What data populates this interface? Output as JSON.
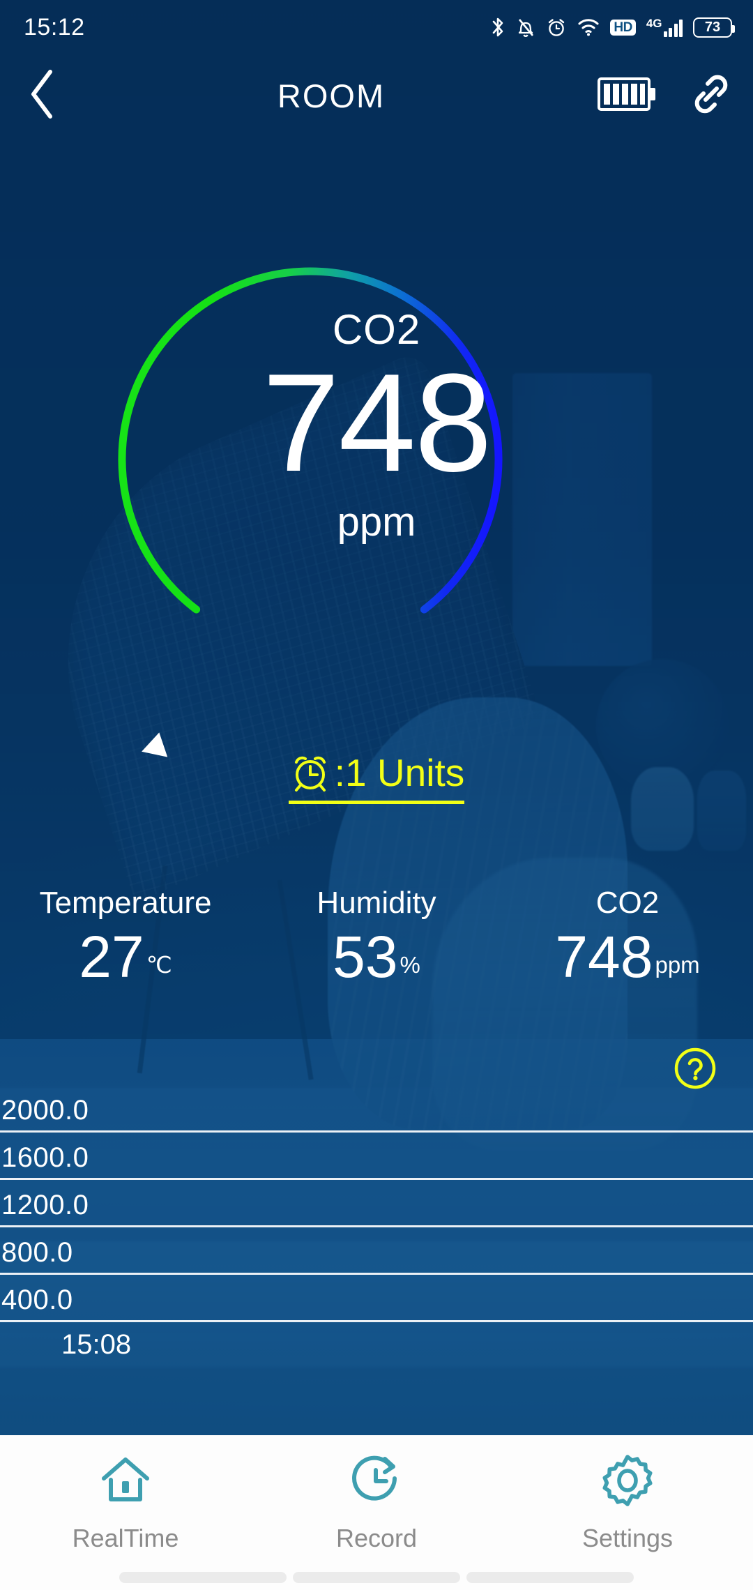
{
  "status_bar": {
    "time": "15:12",
    "battery_percent": "73",
    "hd_label": "HD",
    "network_label": "4G",
    "icons": [
      "bluetooth-icon",
      "bell-muted-icon",
      "alarm-icon",
      "wifi-icon",
      "hd-icon",
      "signal-4g-icon",
      "battery-icon"
    ]
  },
  "header": {
    "title": "ROOM",
    "back_icon": "chevron-left-icon",
    "device_battery_icon": "device-battery-icon",
    "link_icon": "link-icon"
  },
  "gauge": {
    "label": "CO2",
    "value": "748",
    "unit": "ppm",
    "min": 0,
    "max": 2000,
    "color_start": "#17e317",
    "color_mid": "#0f8fb8",
    "color_end": "#1515ff",
    "pointer_icon": "gauge-pointer-triangle"
  },
  "alarm": {
    "icon": "alarm-clock-icon",
    "text": ":1 Units",
    "color": "#f2ff16"
  },
  "metrics": [
    {
      "title": "Temperature",
      "value": "27",
      "unit": "℃"
    },
    {
      "title": "Humidity",
      "value": "53",
      "unit": "%"
    },
    {
      "title": "CO2",
      "value": "748",
      "unit": "ppm"
    }
  ],
  "help": {
    "icon": "help-circle-icon",
    "glyph": "?",
    "color": "#f2ff16"
  },
  "chart_data": {
    "type": "line",
    "title": "",
    "xlabel": "",
    "ylabel": "",
    "y_ticks": [
      "2000.0",
      "1600.0",
      "1200.0",
      "800.0",
      "400.0"
    ],
    "ylim": [
      0,
      2000
    ],
    "x_ticks": [
      "15:08"
    ],
    "series": [
      {
        "name": "CO2",
        "values": []
      }
    ],
    "grid": true,
    "legend": "none"
  },
  "bottom_nav": {
    "items": [
      {
        "label": "RealTime",
        "icon": "home-icon",
        "active": true
      },
      {
        "label": "Record",
        "icon": "clock-history-icon",
        "active": false
      },
      {
        "label": "Settings",
        "icon": "gear-icon",
        "active": false
      }
    ],
    "accent_color": "#3e9fb0"
  }
}
